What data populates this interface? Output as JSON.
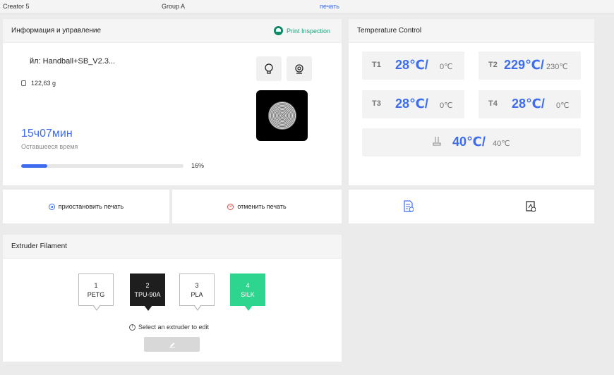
{
  "topbar": {
    "printer": "Creator 5",
    "group": "Group A",
    "print_link": "печать"
  },
  "info": {
    "title": "Информация и управление",
    "inspection": "Print Inspection",
    "filename": "йл: Handball+SB_V2.3...",
    "weight": "122,63 g",
    "time_remaining": "15ч07мин",
    "time_label": "Оставшееся время",
    "progress_percent": 16,
    "progress_text": "16%"
  },
  "actions": {
    "pause": "приостановить печать",
    "cancel": "отменить печать"
  },
  "temperature": {
    "title": "Temperature  Control",
    "t1": {
      "label": "T1",
      "value": "28℃/",
      "target": "0℃"
    },
    "t2": {
      "label": "T2",
      "value": "229℃/",
      "target": "230℃"
    },
    "t3": {
      "label": "T3",
      "value": "28℃/",
      "target": "0℃"
    },
    "t4": {
      "label": "T4",
      "value": "28℃/",
      "target": "0℃"
    },
    "bed": {
      "value": "40℃/",
      "target": "40℃"
    }
  },
  "extruder": {
    "title": "Extruder  Filament",
    "items": [
      {
        "num": "1",
        "material": "PETG"
      },
      {
        "num": "2",
        "material": "TPU-90A"
      },
      {
        "num": "3",
        "material": "PLA"
      },
      {
        "num": "4",
        "material": "SILK"
      }
    ],
    "hint": "Select an extruder to edit"
  },
  "colors": {
    "accent": "#3d6cf0",
    "green": "#2ed58e",
    "dark": "#1e1e1e",
    "inspection": "#1aa37a"
  },
  "icons": [
    "print-inspection-icon",
    "bulb-icon",
    "camera-icon",
    "weight-icon",
    "pause-icon",
    "cancel-icon",
    "bed-icon",
    "document-icon",
    "printer-icon",
    "info-icon",
    "pencil-icon"
  ]
}
